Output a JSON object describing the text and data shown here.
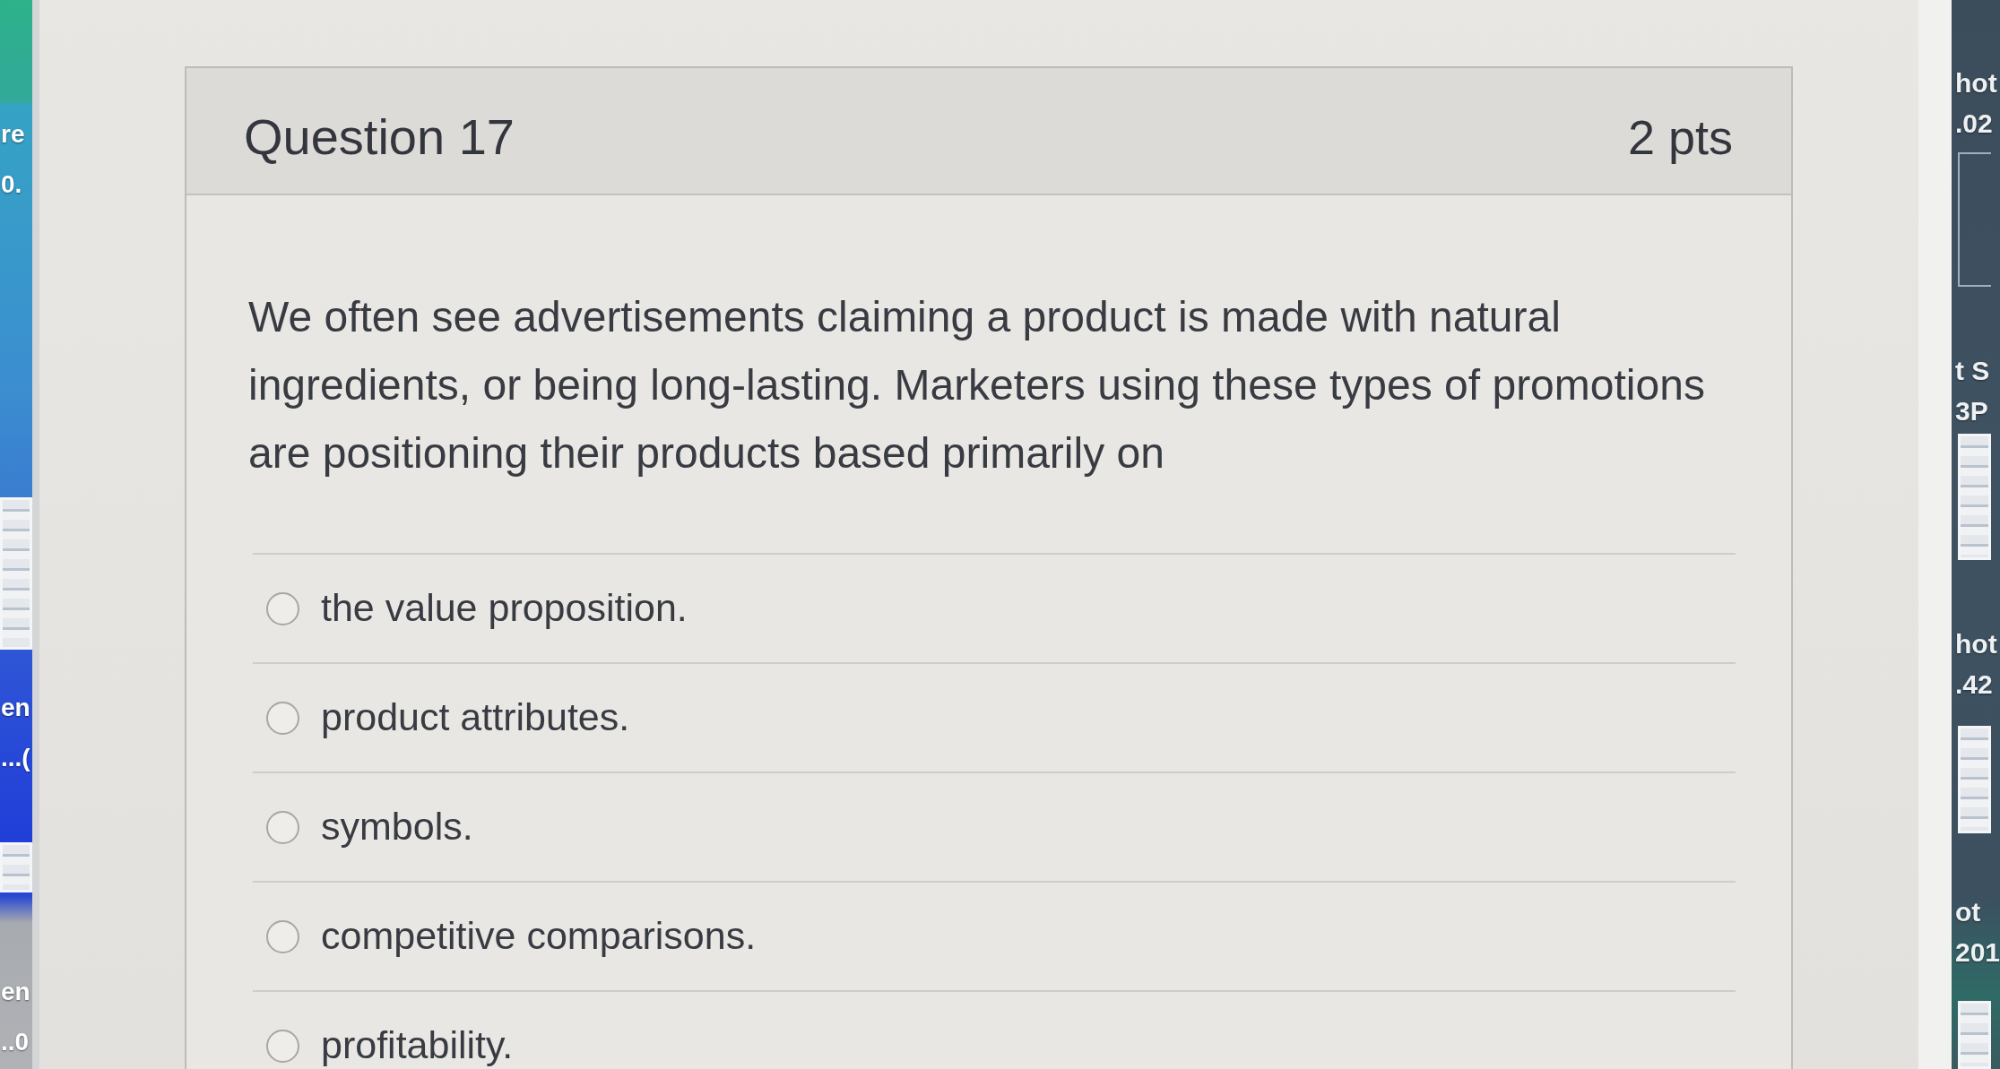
{
  "desktop_left": {
    "icons": [
      {
        "caption": [
          "re",
          "0."
        ]
      },
      {
        "caption": [
          "en",
          "...("
        ]
      },
      {
        "caption": [
          "en",
          "..0"
        ]
      }
    ]
  },
  "question": {
    "title": "Question 17",
    "points": "2 pts",
    "text": "We often see advertisements claiming a product is made with natural ingredients, or being long-lasting. Marketers using these types of promotions are positioning their products based primarily on",
    "answers": [
      {
        "label": "the value proposition.",
        "selected": false
      },
      {
        "label": "product attributes.",
        "selected": false
      },
      {
        "label": "symbols.",
        "selected": false
      },
      {
        "label": "competitive comparisons.",
        "selected": false
      },
      {
        "label": "profitability.",
        "selected": false
      }
    ]
  },
  "desktop_right": {
    "icons": [
      {
        "caption": [
          "hot",
          ".02"
        ]
      },
      {
        "caption": [
          "t S",
          "3P"
        ]
      },
      {
        "caption": [
          "hot",
          ".42"
        ]
      },
      {
        "caption": [
          "ot",
          "201"
        ]
      }
    ]
  }
}
